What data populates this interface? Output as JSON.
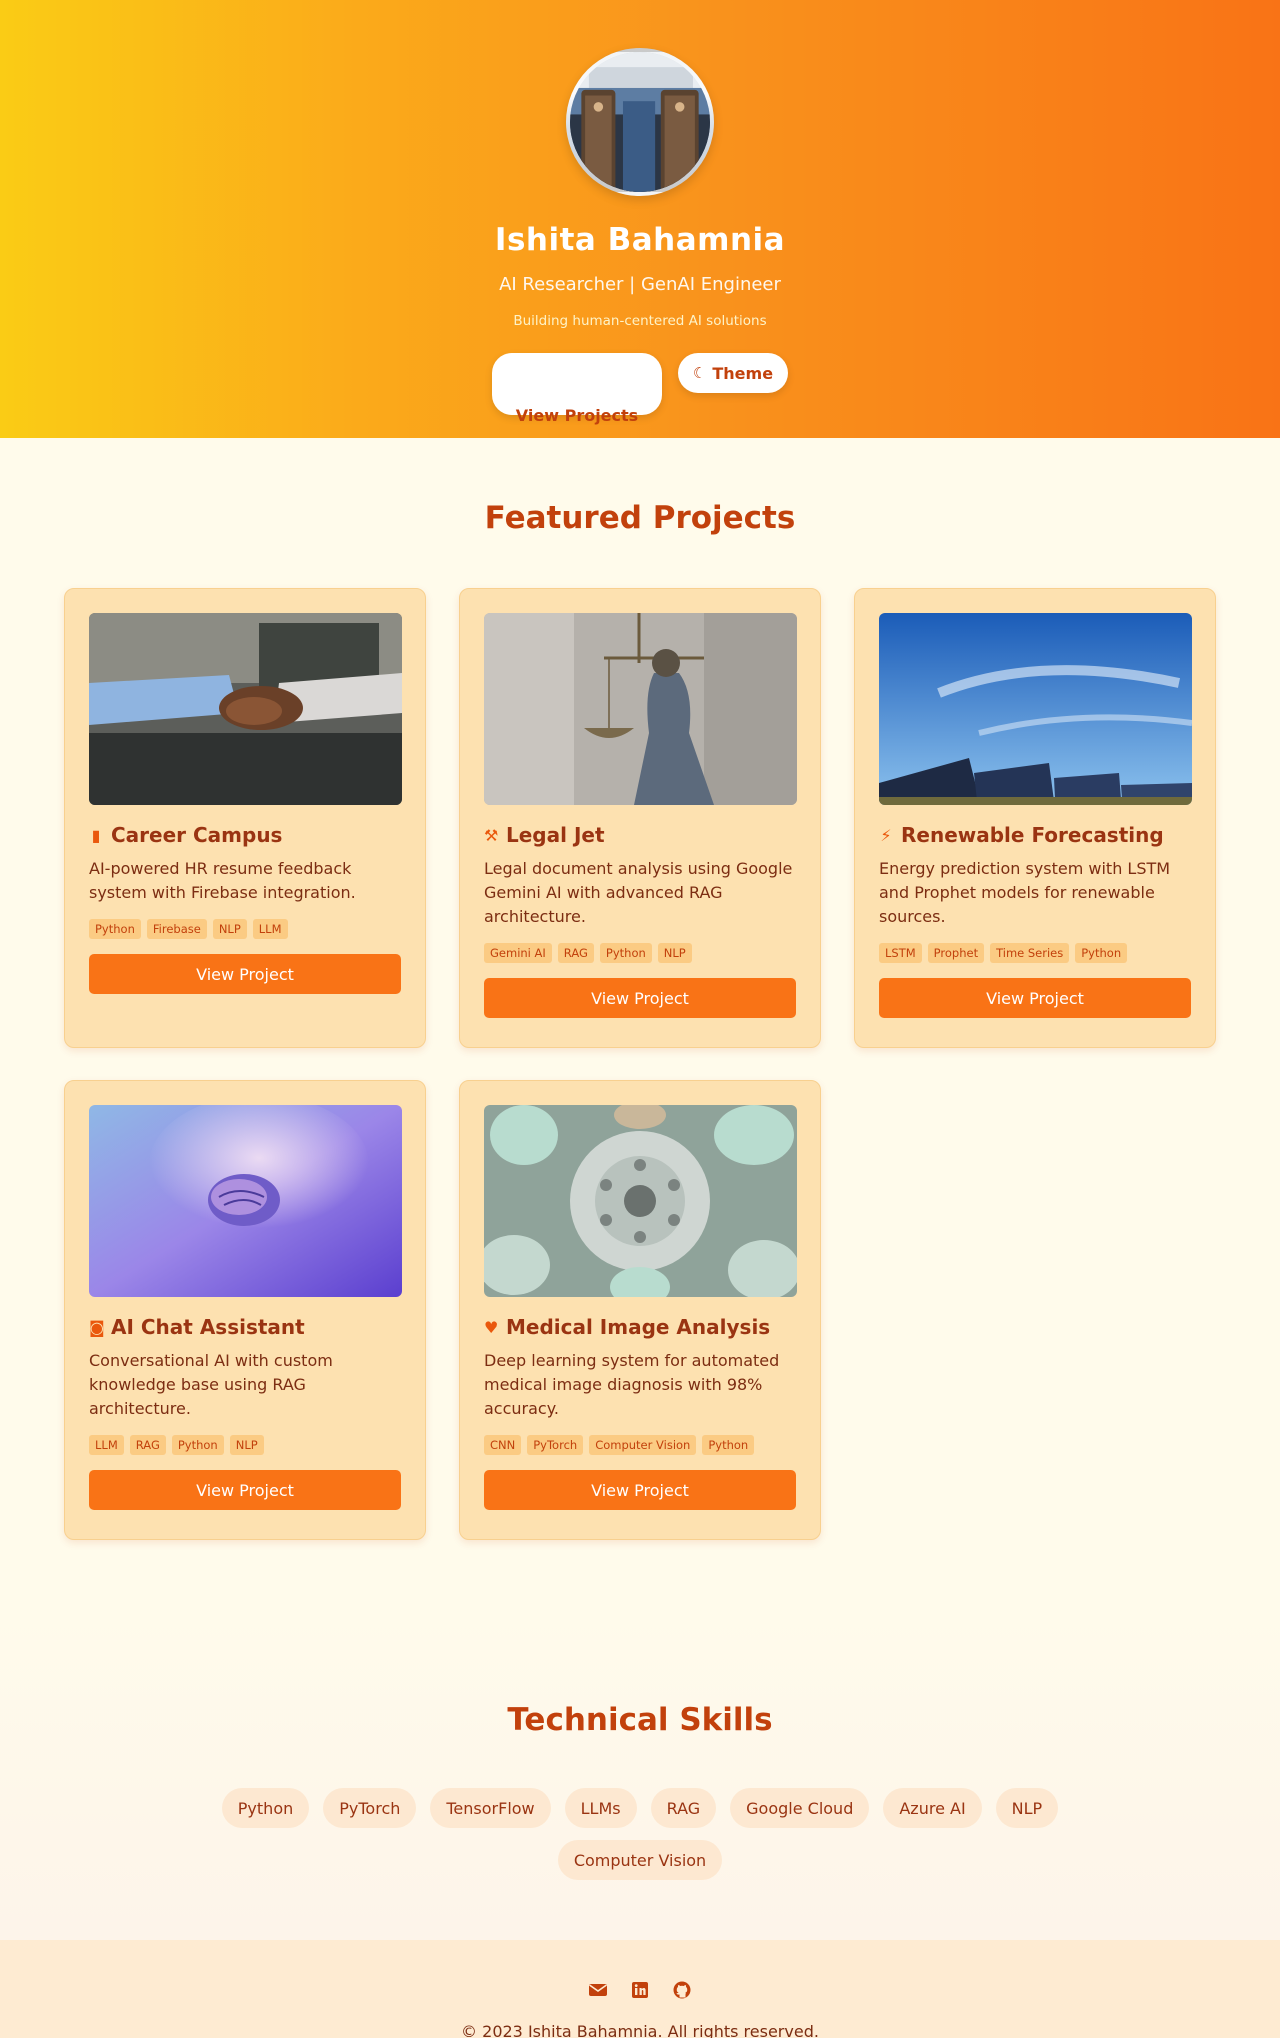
{
  "hero": {
    "name": "Ishita Bahamnia",
    "role": "AI Researcher | GenAI Engineer",
    "tagline": "Building human-centered AI solutions",
    "view_projects_label": "View Projects",
    "theme_label": "Theme",
    "theme_icon": "moon-icon",
    "avatar_description": "photo-avatar"
  },
  "projects": {
    "title": "Featured Projects",
    "items": [
      {
        "title": "Career Campus",
        "icon": "file-icon",
        "glyph": "▮",
        "description": "AI-powered HR resume feedback system with Firebase integration.",
        "tags": [
          "Python",
          "Firebase",
          "NLP",
          "LLM"
        ],
        "button": "View Project"
      },
      {
        "title": "Legal Jet",
        "icon": "gavel-icon",
        "glyph": "⚒",
        "description": "Legal document analysis using Google Gemini AI with advanced RAG architecture.",
        "tags": [
          "Gemini AI",
          "RAG",
          "Python",
          "NLP"
        ],
        "button": "View Project"
      },
      {
        "title": "Renewable Forecasting",
        "icon": "bolt-icon",
        "glyph": "⚡",
        "description": "Energy prediction system with LSTM and Prophet models for renewable sources.",
        "tags": [
          "LSTM",
          "Prophet",
          "Time Series",
          "Python"
        ],
        "button": "View Project"
      },
      {
        "title": "AI Chat Assistant",
        "icon": "robot-icon",
        "glyph": "◙",
        "description": "Conversational AI with custom knowledge base using RAG architecture.",
        "tags": [
          "LLM",
          "RAG",
          "Python",
          "NLP"
        ],
        "button": "View Project"
      },
      {
        "title": "Medical Image Analysis",
        "icon": "heartbeat-icon",
        "glyph": "♥",
        "description": "Deep learning system for automated medical image diagnosis with 98% accuracy.",
        "tags": [
          "CNN",
          "PyTorch",
          "Computer Vision",
          "Python"
        ],
        "button": "View Project"
      }
    ]
  },
  "skills": {
    "title": "Technical Skills",
    "items": [
      "Python",
      "PyTorch",
      "TensorFlow",
      "LLMs",
      "RAG",
      "Google Cloud",
      "Azure AI",
      "NLP",
      "Computer Vision"
    ]
  },
  "footer": {
    "icons": [
      "envelope-icon",
      "linkedin-icon",
      "github-icon"
    ],
    "copyright": "© 2023 Ishita Bahamnia. All rights reserved."
  },
  "colors": {
    "accent": "#f97316",
    "heading": "#c2410c",
    "card_bg": "#fde1b0",
    "page_bg": "#fffbeb"
  }
}
